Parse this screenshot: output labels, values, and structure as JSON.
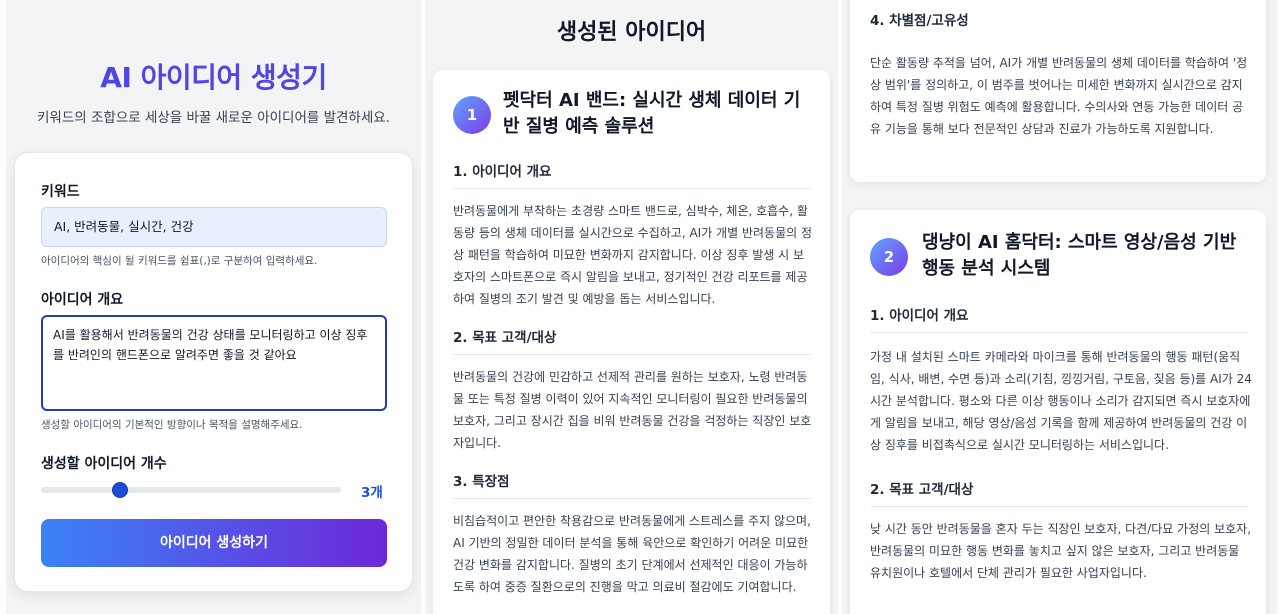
{
  "generator": {
    "title": "AI 아이디어 생성기",
    "subtitle": "키워드의 조합으로 세상을 바꿀 새로운 아이디어를 발견하세요.",
    "keywords_label": "키워드",
    "keywords_value": "AI, 반려동물, 실시간, 건강",
    "keywords_hint": "아이디어의 핵심이 될 키워드를 쉼표(,)로 구분하여 입력하세요.",
    "overview_label": "아이디어 개요",
    "overview_value": "AI를 활용해서 반려동물의 건강 상태를 모니터링하고 이상 징후를 반려인의 핸드폰으로 알려주면 좋을 것 같아요",
    "overview_hint": "생성할 아이디어의 기본적인 방향이나 목적을 설명해주세요.",
    "count_label": "생성할 아이디어 개수",
    "count_value": "3개",
    "count_level": 0.25,
    "generate_button": "아이디어 생성하기"
  },
  "results": {
    "title": "생성된 아이디어",
    "ideas": [
      {
        "number": "1",
        "title": "펫닥터 AI 밴드: 실시간 생체 데이터 기반 질병 예측 솔루션",
        "sections": [
          {
            "heading": "1. 아이디어 개요",
            "body": "반려동물에게 부착하는 초경량 스마트 밴드로, 심박수, 체온, 호흡수, 활동량 등의 생체 데이터를 실시간으로 수집하고, AI가 개별 반려동물의 정상 패턴을 학습하여 미묘한 변화까지 감지합니다. 이상 징후 발생 시 보호자의 스마트폰으로 즉시 알림을 보내고, 정기적인 건강 리포트를 제공하여 질병의 조기 발견 및 예방을 돕는 서비스입니다."
          },
          {
            "heading": "2. 목표 고객/대상",
            "body": "반려동물의 건강에 민감하고 선제적 관리를 원하는 보호자, 노령 반려동물 또는 특정 질병 이력이 있어 지속적인 모니터링이 필요한 반려동물의 보호자, 그리고 장시간 집을 비워 반려동물 건강을 걱정하는 직장인 보호자입니다."
          },
          {
            "heading": "3. 특장점",
            "body": "비침습적이고 편안한 착용감으로 반려동물에게 스트레스를 주지 않으며, AI 기반의 정밀한 데이터 분석을 통해 육안으로 확인하기 어려운 미묘한 건강 변화를 감지합니다. 질병의 초기 단계에서 선제적인 대응이 가능하도록 하여 중증 질환으로의 진행을 막고 의료비 절감에도 기여합니다."
          },
          {
            "heading": "4. 차별점/고유성",
            "body": "단순 활동량 추적을 넘어, AI가 개별 반려동물의 생체 데이터를 학습하여 '정상 범위'를 정의하고, 이 범주를 벗어나는 미세한 변화까지 실시간으로 감지하여 특정 질병 위험도 예측에 활용합니다. 수의사와 연동 가능한 데이터 공유 기능을 통해 보다 전문적인 상담과 진료가 가능하도록 지원합니다."
          }
        ]
      },
      {
        "number": "2",
        "title": "댕냥이 AI 홈닥터: 스마트 영상/음성 기반 행동 분석 시스템",
        "sections": [
          {
            "heading": "1. 아이디어 개요",
            "body": "가정 내 설치된 스마트 카메라와 마이크를 통해 반려동물의 행동 패턴(움직임, 식사, 배변, 수면 등)과 소리(기침, 낑낑거림, 구토음, 짖음 등)를 AI가 24시간 분석합니다. 평소와 다른 이상 행동이나 소리가 감지되면 즉시 보호자에게 알림을 보내고, 해당 영상/음성 기록을 함께 제공하여 반려동물의 건강 이상 징후를 비접촉식으로 실시간 모니터링하는 서비스입니다."
          },
          {
            "heading": "2. 목표 고객/대상",
            "body": "낮 시간 동안 반려동물을 혼자 두는 직장인 보호자, 다견/다묘 가정의 보호자, 반려동물의 미묘한 행동 변화를 놓치고 싶지 않은 보호자, 그리고 반려동물 유치원이나 호텔에서 단체 관리가 필요한 사업자입니다."
          }
        ]
      }
    ]
  }
}
